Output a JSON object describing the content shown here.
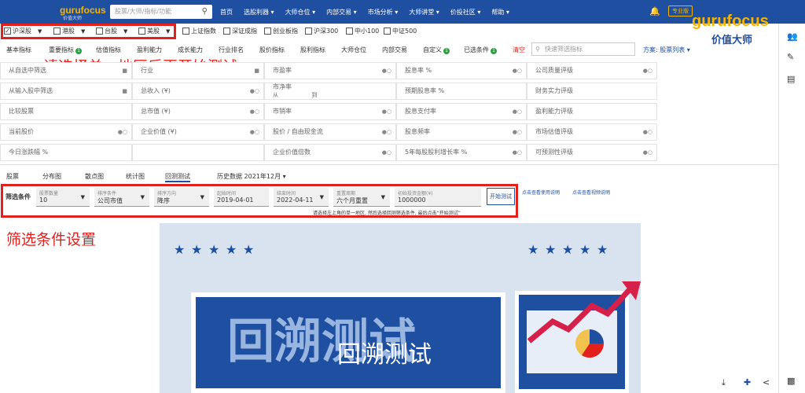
{
  "topbar": {
    "logo": "gurufocus",
    "logo_sub": "价值大师",
    "search_placeholder": "股票/大师/指标/功能",
    "nav": [
      "首页",
      "选股利器 ▾",
      "大师仓位 ▾",
      "内部交易 ▾",
      "市场分析 ▾",
      "大师讲堂 ▾",
      "价投社区 ▾",
      "帮助 ▾"
    ],
    "pro_label": "专业版",
    "watermark": "gurufocus",
    "watermark_sub": "价值大师"
  },
  "regions": [
    {
      "label": "沪深股",
      "checked": true
    },
    {
      "label": "港股",
      "checked": false
    },
    {
      "label": "台股",
      "checked": false
    },
    {
      "label": "美股",
      "checked": false
    }
  ],
  "indices": [
    "上证指数",
    "深证成指",
    "创业板指",
    "沪深300",
    "中小100",
    "中证500"
  ],
  "tabs": [
    {
      "label": "基本指标",
      "badge": ""
    },
    {
      "label": "重要指标",
      "badge": "1"
    },
    {
      "label": "估值指标",
      "badge": ""
    },
    {
      "label": "盈利能力",
      "badge": ""
    },
    {
      "label": "成长能力",
      "badge": ""
    },
    {
      "label": "行业排名",
      "badge": ""
    },
    {
      "label": "股价指标",
      "badge": ""
    },
    {
      "label": "股利指标",
      "badge": ""
    },
    {
      "label": "大师仓位",
      "badge": ""
    },
    {
      "label": "内部交易",
      "badge": ""
    },
    {
      "label": "自定义",
      "badge": "1"
    },
    {
      "label": "已选条件",
      "badge": "1"
    },
    {
      "label": "清空",
      "badge": ""
    }
  ],
  "annotation1": "请选择单一地区后再开始测试",
  "annotation2": "筛选条件设置",
  "search_indicator_placeholder": "快速筛选指标",
  "scheme_label": "方案: 股票列表 ▾",
  "grid": {
    "col1": [
      "从自选中筛选",
      "从输入股中筛选",
      "比较股票",
      "当前股价",
      "今日涨跌幅 %"
    ],
    "col2": [
      "行业",
      "总收入 (¥)",
      "总市值 (¥)",
      "企业价值 (¥)",
      ""
    ],
    "col3": [
      "市盈率",
      "市净率",
      "市销率",
      "股价 / 自由现金流",
      "企业价值倍数"
    ],
    "col3_range": [
      "从",
      "到"
    ],
    "col4": [
      "股息率 %",
      "预期股息率 %",
      "股息支付率",
      "股息频率",
      "5年每股股利增长率 %"
    ],
    "col5": [
      "公司质量评级",
      "财务实力评级",
      "盈利能力评级",
      "市场估值评级",
      "可预测性评级"
    ]
  },
  "subtabs": [
    "股票",
    "分布图",
    "散点图",
    "统计图",
    "回测测试",
    "历史数据 2021年12月 ▾"
  ],
  "backtest_badge": "",
  "filter": {
    "label": "筛选条件",
    "fields": [
      {
        "title": "股票数量",
        "value": "10"
      },
      {
        "title": "排序条件",
        "value": "公司市值"
      },
      {
        "title": "排序方向",
        "value": "降序"
      },
      {
        "title": "起始时间",
        "value": "2019-04-01"
      },
      {
        "title": "结束时间",
        "value": "2022-04-11"
      },
      {
        "title": "重置周期",
        "value": "六个月重置"
      },
      {
        "title": "初始投资金额(¥)",
        "value": "1000000"
      }
    ],
    "start_button": "开始测试",
    "hint": "请选择左上角的单一地区, 然后选择回测筛选条件, 最后点击“开始测试”",
    "link1": "点击查看使用说明",
    "link2": "点击查看视频说明"
  },
  "banner": {
    "title_big": "回溯测试",
    "title_small": "回溯测试"
  }
}
